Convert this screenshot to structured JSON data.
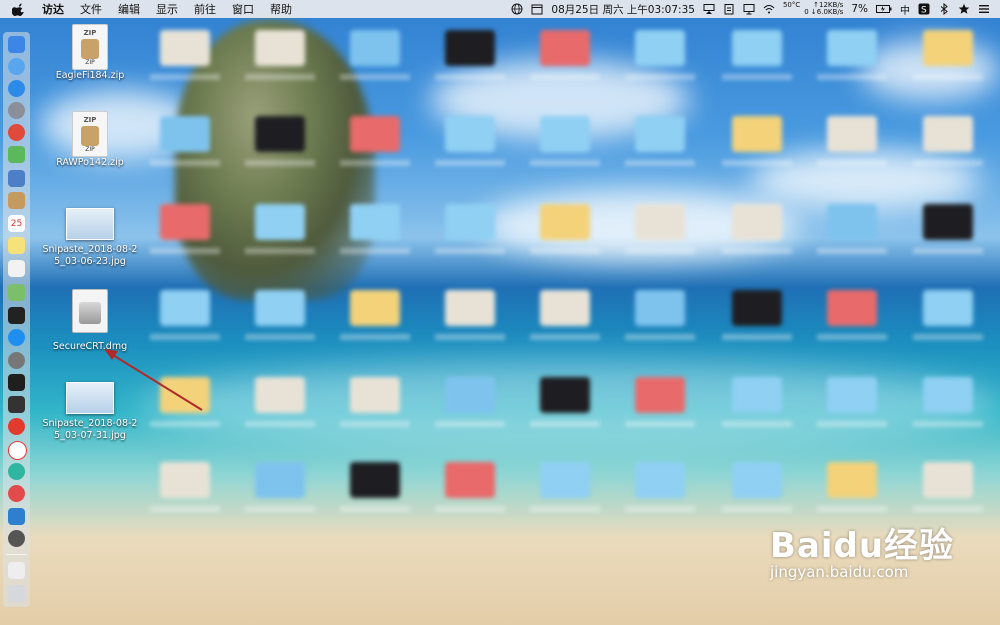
{
  "menubar": {
    "app_name": "访达",
    "menus": [
      "文件",
      "编辑",
      "显示",
      "前往",
      "窗口",
      "帮助"
    ],
    "date": "08月25日 周六 上午03:07:35",
    "temp": "50°C",
    "net_up": "↑12KB/s",
    "net_down": "0 ↓6.0KB/s",
    "battery": "7%",
    "input_method": "中"
  },
  "desktop_files": [
    {
      "label": "EagleFi184.zip",
      "kind": "zip"
    },
    {
      "label": "RAWPo142.zip",
      "kind": "zip"
    },
    {
      "label": "Snipaste_2018-08-25_03-06-23.jpg",
      "kind": "image"
    },
    {
      "label": "SecureCRT.dmg",
      "kind": "dmg"
    },
    {
      "label": "Snipaste_2018-08-25_03-07-31.jpg",
      "kind": "image"
    }
  ],
  "dock_calendar_day": "25",
  "watermark": {
    "brand": "Baidu经验",
    "url": "jingyan.baidu.com"
  },
  "colors": {
    "accent_arrow": "#b02a2a",
    "menubar": "#ececee"
  }
}
